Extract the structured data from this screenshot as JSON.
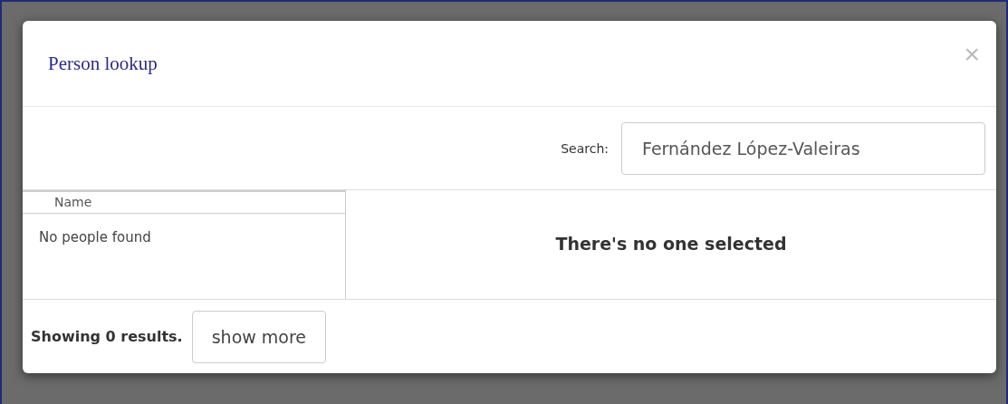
{
  "dialog": {
    "title": "Person lookup",
    "close": "×"
  },
  "search": {
    "label": "Search:",
    "value": "Fernández López-Valeiras"
  },
  "results": {
    "columns": [
      "Name"
    ],
    "empty_text": "No people found"
  },
  "detail": {
    "message": "There's no one selected"
  },
  "footer": {
    "summary": "Showing 0 results.",
    "button": "show more"
  }
}
